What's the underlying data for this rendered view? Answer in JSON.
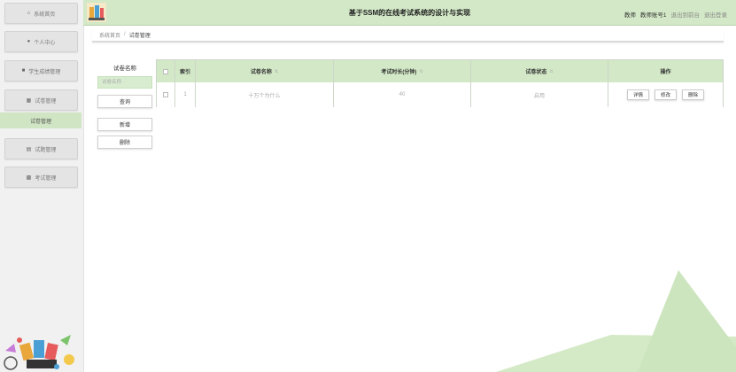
{
  "sidebar": {
    "items": [
      {
        "label": "系统首页",
        "icon": "home-icon"
      },
      {
        "label": "个人中心",
        "icon": "user-icon"
      },
      {
        "label": "学生成绩管理",
        "icon": "book-icon"
      },
      {
        "label": "试卷管理",
        "icon": "grid-icon"
      },
      {
        "label": "试题管理",
        "icon": "list-icon"
      },
      {
        "label": "考试管理",
        "icon": "doc-icon"
      }
    ],
    "active_sub": "试卷管理"
  },
  "header": {
    "title": "基于SSM的在线考试系统的设计与实现",
    "role": "教师",
    "account": "教师账号1",
    "back_link": "退出到前台",
    "logout_link": "退出登录"
  },
  "breadcrumb": {
    "home": "系统首页",
    "separator": "/",
    "current": "试卷管理"
  },
  "filter": {
    "label": "试卷名称",
    "placeholder": "试卷名称",
    "search_label": "查询",
    "add_label": "新增",
    "delete_label": "删除"
  },
  "table": {
    "columns": [
      "索引",
      "试卷名称",
      "考试时长(分钟)",
      "试卷状态",
      "操作"
    ],
    "rows": [
      {
        "index": "1",
        "name": "十万个为什么",
        "duration": "40",
        "status": "启用",
        "actions": [
          "详情",
          "修改",
          "删除"
        ]
      }
    ]
  },
  "colors": {
    "accent": "#d2e8c6",
    "sidebar_bg": "#f1f1f1",
    "deco": "#d4e9c6"
  }
}
